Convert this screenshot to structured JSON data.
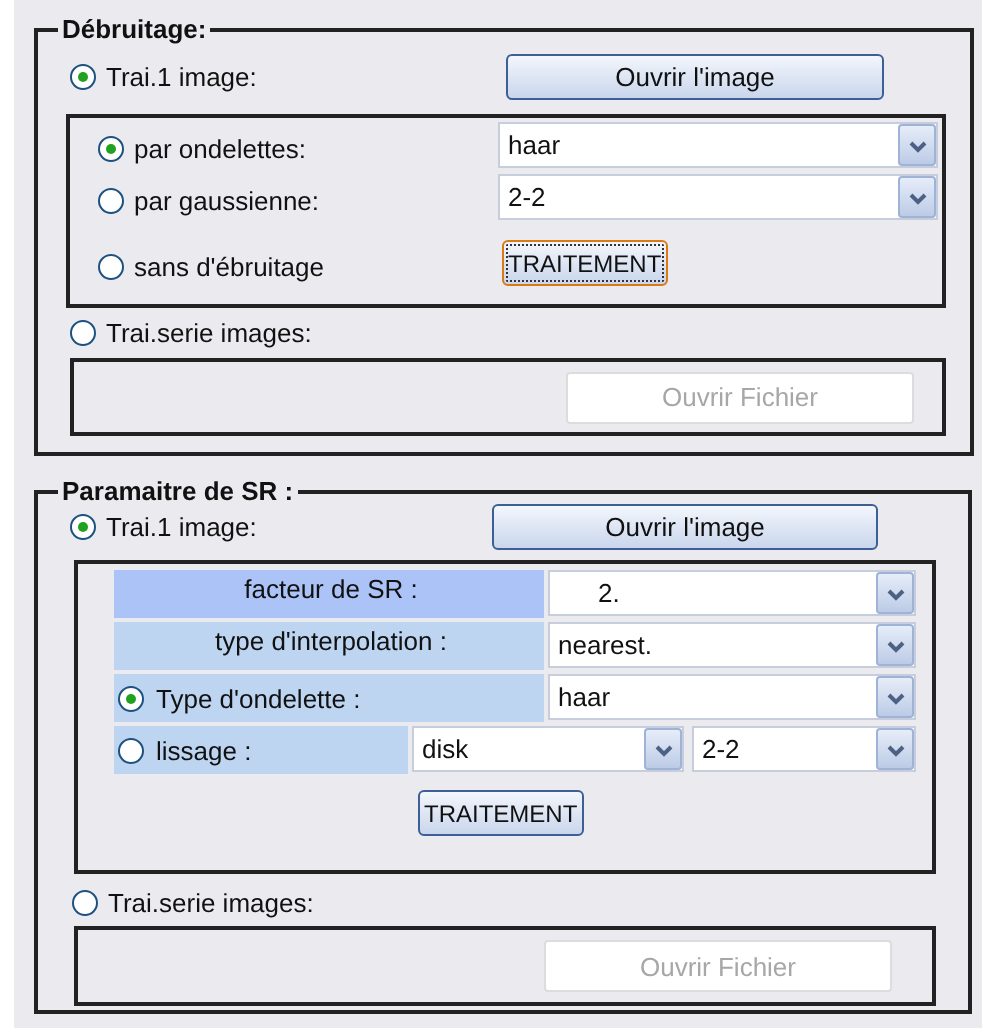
{
  "denoising": {
    "title": "Débruitage:",
    "single_mode": {
      "label": "Trai.1 image:",
      "selected": true
    },
    "open_image_button": "Ouvrir l'image",
    "methods": [
      {
        "kind": "select",
        "label": "par ondelettes:",
        "selected": true,
        "value": "haar"
      },
      {
        "kind": "select",
        "label": "par gaussienne:",
        "selected": false,
        "value": "2-2"
      },
      {
        "kind": "button",
        "label": "sans d'ébruitage",
        "selected": false,
        "button": "TRAITEMENT",
        "focused": true
      }
    ],
    "series_mode": {
      "label": "Trai.serie images:",
      "selected": false
    },
    "open_file_button": {
      "label": "Ouvrir Fichier",
      "disabled": true
    }
  },
  "sr_params": {
    "title": "Paramaitre de SR :",
    "single_mode": {
      "label": "Trai.1 image:",
      "selected": true
    },
    "open_image_button": "Ouvrir l'image",
    "params": [
      {
        "kind": "plain",
        "label": "facteur de SR :",
        "color": "#abc3f7",
        "values": [
          "2."
        ]
      },
      {
        "kind": "plain",
        "label": "type d'interpolation :",
        "color": "#bdd5f1",
        "values": [
          "nearest."
        ]
      },
      {
        "kind": "radio",
        "label": "Type d'ondelette :",
        "color": "#bdd5f1",
        "selected": true,
        "values": [
          "haar"
        ]
      },
      {
        "kind": "radio",
        "label": "lissage :",
        "color": "#bdd5f1",
        "selected": false,
        "values": [
          "disk",
          "2-2"
        ]
      }
    ],
    "process_button": {
      "label": "TRAITEMENT",
      "focused": false
    },
    "series_mode": {
      "label": "Trai.serie images:",
      "selected": false
    },
    "open_file_button": {
      "label": "Ouvrir Fichier",
      "disabled": true
    }
  }
}
